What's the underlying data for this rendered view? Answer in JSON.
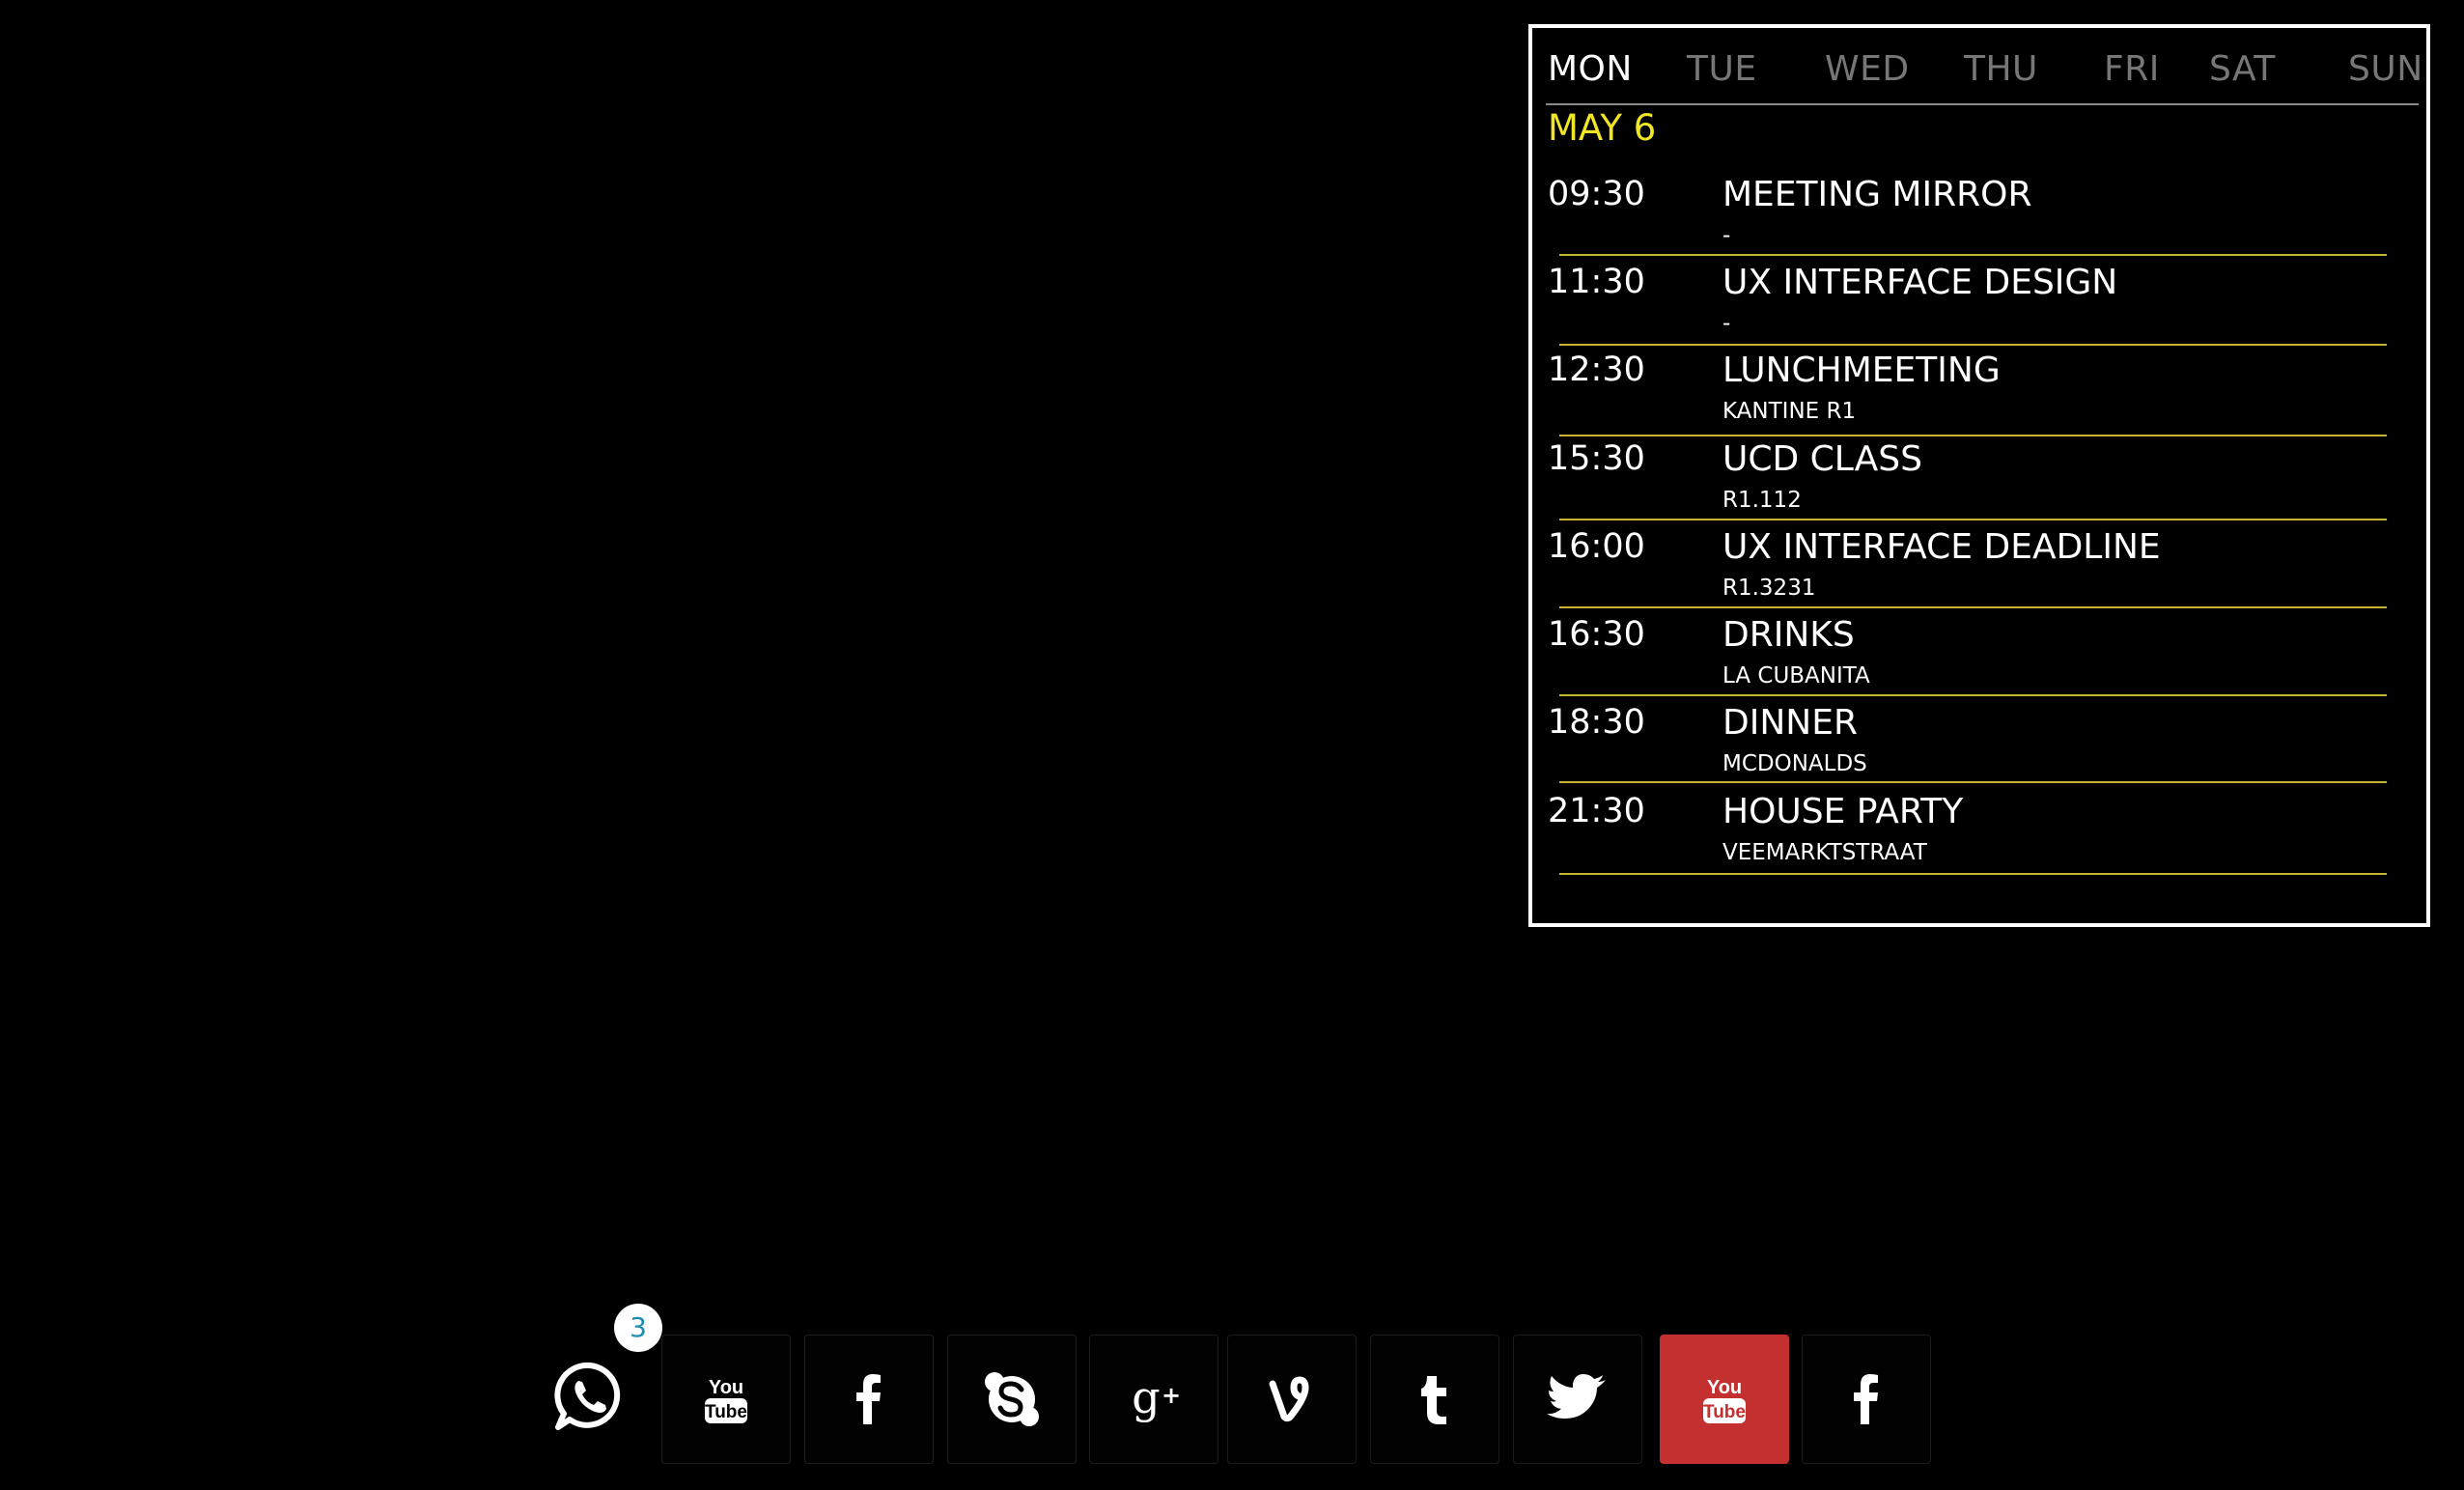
{
  "calendar": {
    "days": [
      {
        "label": "MON",
        "active": true
      },
      {
        "label": "TUE",
        "active": false
      },
      {
        "label": "WED",
        "active": false
      },
      {
        "label": "THU",
        "active": false
      },
      {
        "label": "FRI",
        "active": false
      },
      {
        "label": "SAT",
        "active": false
      },
      {
        "label": "SUN",
        "active": false
      }
    ],
    "date": "MAY 6",
    "events": [
      {
        "time": "09:30",
        "title": "MEETING MIRROR",
        "location": "-"
      },
      {
        "time": "11:30",
        "title": "UX INTERFACE DESIGN",
        "location": "-"
      },
      {
        "time": "12:30",
        "title": "LUNCHMEETING",
        "location": "KANTINE R1"
      },
      {
        "time": "15:30",
        "title": "UCD CLASS",
        "location": "R1.112"
      },
      {
        "time": "16:00",
        "title": "UX INTERFACE DEADLINE",
        "location": "R1.3231"
      },
      {
        "time": "16:30",
        "title": "DRINKS",
        "location": "LA CUBANITA"
      },
      {
        "time": "18:30",
        "title": "DINNER",
        "location": "MCDONALDS"
      },
      {
        "time": "21:30",
        "title": "HOUSE PARTY",
        "location": "VEEMARKTSTRAAT"
      }
    ]
  },
  "colors": {
    "accent": "#f0e623",
    "rule": "#c8b230",
    "youtube_red": "#c42f2f",
    "badge_text": "#1b8fb0"
  },
  "dock": {
    "whatsapp": {
      "icon": "whatsapp-icon",
      "badge_count": "3"
    },
    "apps": [
      {
        "icon": "youtube-icon",
        "highlighted": false
      },
      {
        "icon": "facebook-icon",
        "highlighted": false
      },
      {
        "icon": "skype-icon",
        "highlighted": false
      },
      {
        "icon": "google-plus-icon",
        "highlighted": false
      },
      {
        "icon": "vine-icon",
        "highlighted": false
      },
      {
        "icon": "tumblr-icon",
        "highlighted": false
      },
      {
        "icon": "twitter-icon",
        "highlighted": false
      },
      {
        "icon": "youtube-icon",
        "highlighted": true
      },
      {
        "icon": "facebook-icon",
        "highlighted": false
      }
    ]
  }
}
